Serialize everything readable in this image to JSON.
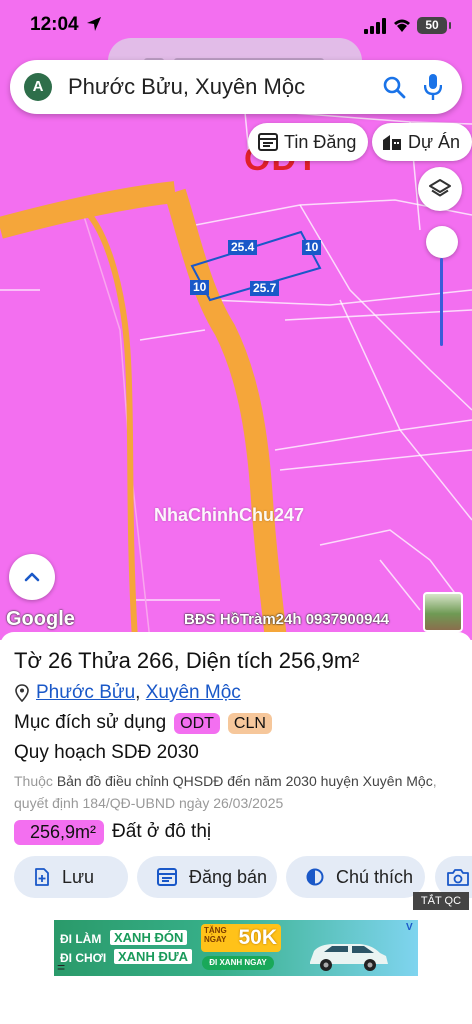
{
  "status_bar": {
    "time": "12:04",
    "battery": "50"
  },
  "search": {
    "avatar_letter": "A",
    "query": "Phước Bửu, Xuyên Mộc"
  },
  "map_chips": [
    {
      "label": "Tin Đăng",
      "icon": "listing-icon"
    },
    {
      "label": "Dự Án",
      "icon": "building-icon"
    }
  ],
  "map": {
    "zone_label": "ODT",
    "dimensions": [
      "25.4",
      "10",
      "10",
      "25.7"
    ],
    "watermark": "NhaChinhChu247",
    "google_logo": "Google",
    "credit": "BĐS HồTràm24h 0937900944",
    "colors": {
      "land": "#f36ff0",
      "road": "#f5a63a",
      "parcel_outline": "#1a58c8"
    }
  },
  "parcel": {
    "title": "Tờ 26 Thửa 266, Diện tích 256,9m²",
    "ward": "Phước Bửu",
    "district": "Xuyên Mộc",
    "purpose_label": "Mục đích sử dụng",
    "tags": [
      {
        "code": "ODT",
        "bg": "#f36ff0"
      },
      {
        "code": "CLN",
        "bg": "#f6c79b"
      }
    ],
    "plan_title": "Quy hoạch SDĐ 2030",
    "decision_prefix": "Thuộc",
    "decision_main": "Bản đồ điều chỉnh QHSDĐ đến năm 2030 huyện Xuyên Mộc",
    "decision_suffix": ", quyết định 184/QĐ-UBND ngày 26/03/2025",
    "area_value": "256,9m²",
    "area_desc": "Đất ở đô thị"
  },
  "actions": [
    {
      "label": "Lưu",
      "icon": "save-icon"
    },
    {
      "label": "Đăng bán",
      "icon": "list-sell-icon"
    },
    {
      "label": "Chú thích",
      "icon": "legend-icon"
    }
  ],
  "ad": {
    "close_label": "TẮT QC",
    "line1": "ĐI LÀM",
    "line1_box": "XANH ĐÓN",
    "line2": "ĐI CHƠI",
    "line2_box": "XANH ĐƯA",
    "bonus_prefix": "TẶNG NGAY",
    "bonus": "50K",
    "cta": "ĐI XANH NGAY",
    "brand": "V"
  }
}
